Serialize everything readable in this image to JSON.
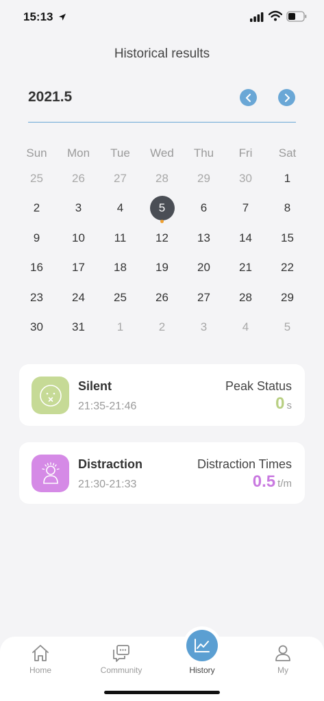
{
  "status_bar": {
    "time": "15:13"
  },
  "header": {
    "title": "Historical results"
  },
  "calendar": {
    "month": "2021.5",
    "weekdays": [
      "Sun",
      "Mon",
      "Tue",
      "Wed",
      "Thu",
      "Fri",
      "Sat"
    ],
    "weeks": [
      [
        "25",
        "26",
        "27",
        "28",
        "29",
        "30",
        "1"
      ],
      [
        "2",
        "3",
        "4",
        "5",
        "6",
        "7",
        "8"
      ],
      [
        "9",
        "10",
        "11",
        "12",
        "13",
        "14",
        "15"
      ],
      [
        "16",
        "17",
        "18",
        "19",
        "20",
        "21",
        "22"
      ],
      [
        "23",
        "24",
        "25",
        "26",
        "27",
        "28",
        "29"
      ],
      [
        "30",
        "31",
        "1",
        "2",
        "3",
        "4",
        "5"
      ]
    ],
    "selected_day": "5",
    "marked_day": "5"
  },
  "records": [
    {
      "name": "Silent",
      "time": "21:35-21:46",
      "stat_label": "Peak Status",
      "stat_value": "0",
      "stat_unit": "s",
      "icon": "silent-face-icon",
      "color": "#c6da96"
    },
    {
      "name": "Distraction",
      "time": "21:30-21:33",
      "stat_label": "Distraction Times",
      "stat_value": "0.5",
      "stat_unit": "t/m",
      "icon": "distracted-person-icon",
      "color": "#d58ae6"
    }
  ],
  "tabs": [
    {
      "label": "Home",
      "icon": "home-icon"
    },
    {
      "label": "Community",
      "icon": "chat-icon"
    },
    {
      "label": "History",
      "icon": "chart-line-icon",
      "active": true
    },
    {
      "label": "My",
      "icon": "person-icon"
    }
  ],
  "colors": {
    "accent": "#5b9fd2",
    "selected_day": "#4a4e55",
    "dot": "#f0a030"
  }
}
